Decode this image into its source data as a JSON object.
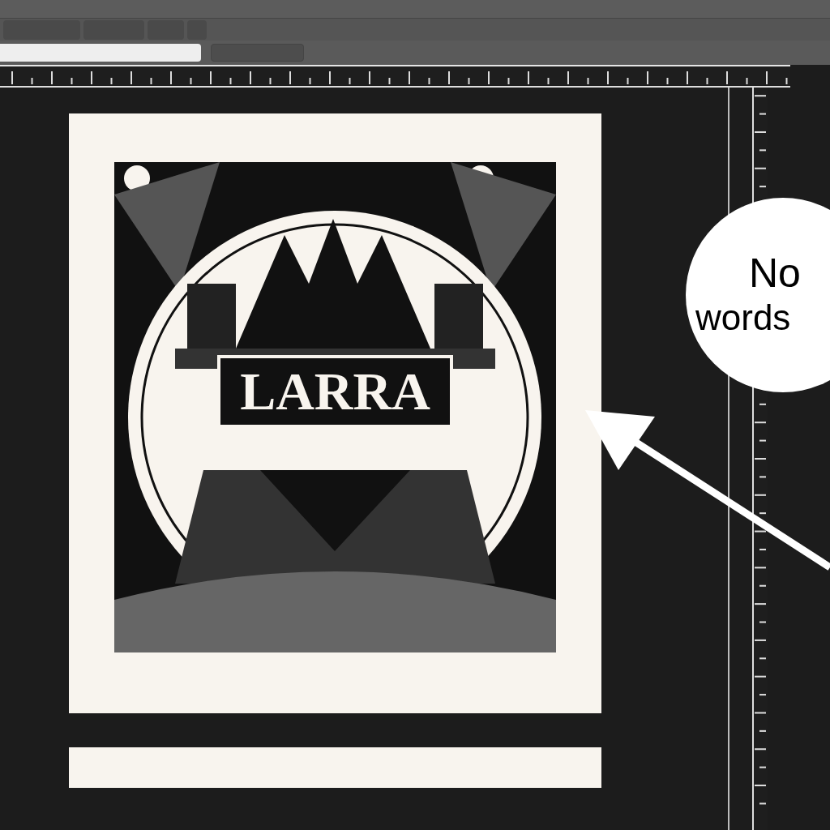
{
  "artwork": {
    "title": "LARRA"
  },
  "callout": {
    "lines": [
      "No",
      "words"
    ]
  }
}
